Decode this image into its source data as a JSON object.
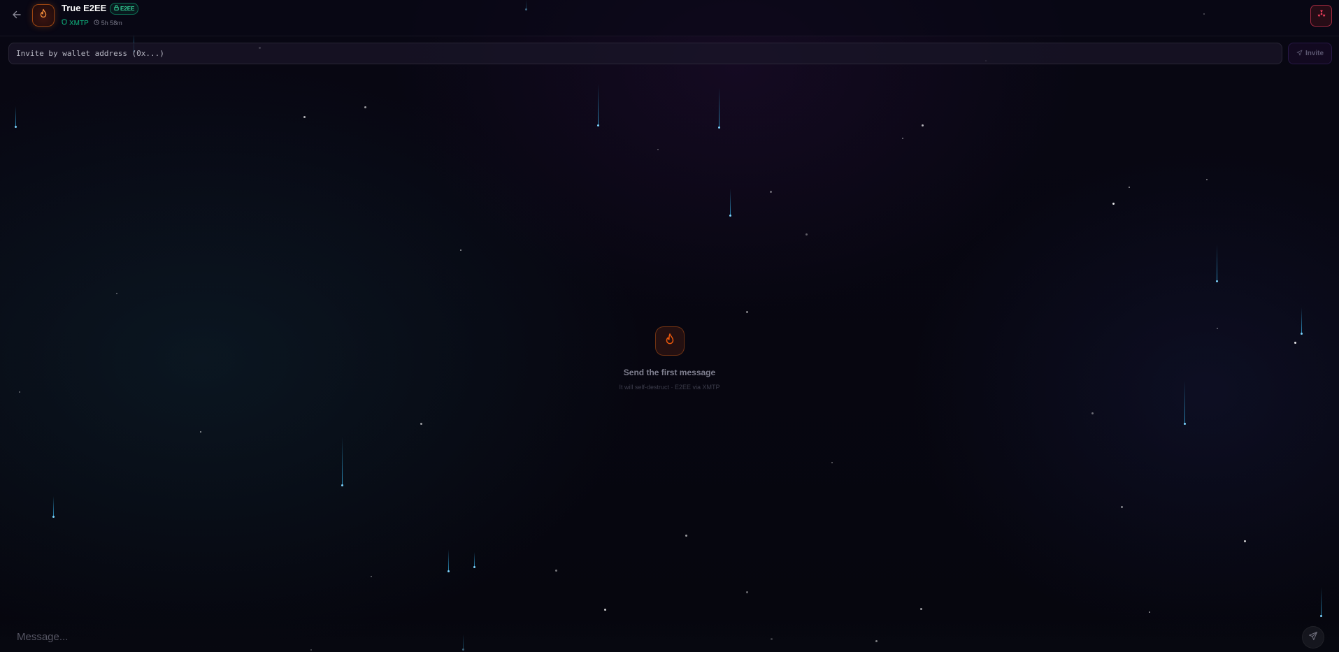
{
  "header": {
    "back_icon": "arrow-left-icon",
    "avatar_icon": "flame-icon",
    "title": "True E2EE",
    "badge_label": "E2EE",
    "badge_icon": "lock-icon",
    "protocol_label": "XMTP",
    "protocol_icon": "shield-icon",
    "timer_label": "5h 58m",
    "timer_icon": "clock-icon",
    "burn_button_icon": "radiation-icon"
  },
  "invite": {
    "placeholder": "Invite by wallet address (0x...)",
    "button_label": "Invite",
    "button_icon": "send-icon"
  },
  "empty_state": {
    "icon": "flame-icon",
    "title": "Send the first message",
    "subtitle": "It will self-destruct · E2EE via XMTP"
  },
  "composer": {
    "placeholder": "Message...",
    "send_icon": "send-icon"
  },
  "colors": {
    "background": "#07070f",
    "accent_orange": "#f97316",
    "accent_green": "#10b981",
    "accent_red": "#f43f5e",
    "streak_cyan": "#38bdf8"
  }
}
